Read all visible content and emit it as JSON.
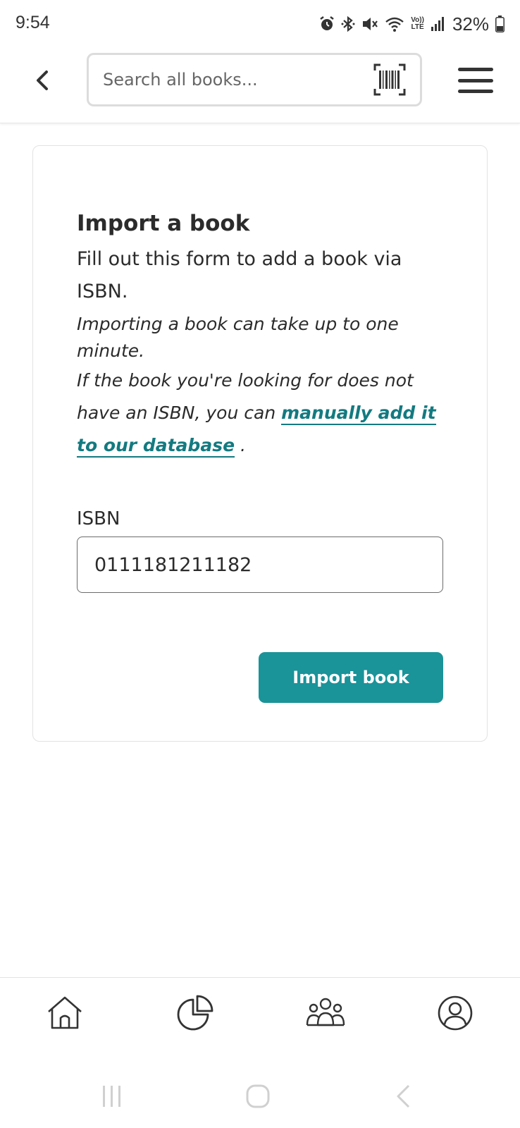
{
  "status_bar": {
    "time": "9:54",
    "battery": "32%",
    "network_top": "Vo))",
    "network_bottom": "LTE",
    "icons": [
      "alarm-icon",
      "bluetooth-icon",
      "mute-icon",
      "wifi-icon",
      "signal-icon",
      "battery-icon"
    ]
  },
  "header": {
    "search_placeholder": "Search all books...",
    "search_value": "",
    "back_icon": "chevron-left-icon",
    "barcode_icon": "barcode-scan-icon",
    "menu_icon": "hamburger-menu-icon"
  },
  "card": {
    "title": "Import a book",
    "description": "Fill out this form to add a book via ISBN.",
    "note": "Importing a book can take up to one minute.",
    "note2_prefix": "If the book you're looking for does not have an ISBN, you can ",
    "link_text": "manually add it to our database",
    "note2_suffix": " .",
    "isbn_label": "ISBN",
    "isbn_value": "0111181211182",
    "submit_label": "Import book"
  },
  "tabs": [
    {
      "icon": "home-icon"
    },
    {
      "icon": "stats-pie-chart-icon"
    },
    {
      "icon": "community-people-icon"
    },
    {
      "icon": "profile-user-icon"
    }
  ],
  "android_nav": [
    "recent-apps-icon",
    "home-circle-icon",
    "back-icon"
  ],
  "colors": {
    "accent": "#1a9399",
    "link": "#137a80",
    "text": "#2b2b2b"
  }
}
